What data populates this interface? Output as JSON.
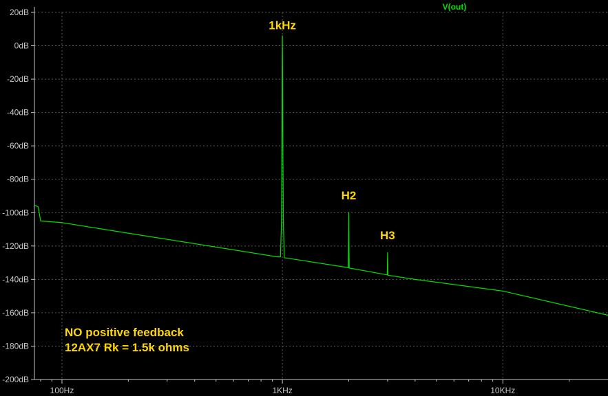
{
  "chart_data": {
    "type": "line",
    "trace_label": "V(out)",
    "x_scale": "log",
    "xlim_hz": [
      75,
      30000
    ],
    "ylim_db": [
      -200,
      20
    ],
    "y_ticks": [
      "20dB",
      "0dB",
      "-20dB",
      "-40dB",
      "-60dB",
      "-80dB",
      "-100dB",
      "-120dB",
      "-140dB",
      "-160dB",
      "-180dB",
      "-200dB"
    ],
    "x_ticks": [
      {
        "label": "100Hz",
        "freq": 100
      },
      {
        "label": "1KHz",
        "freq": 1000
      },
      {
        "label": "10KHz",
        "freq": 10000
      }
    ],
    "grid": true,
    "colors": {
      "trace": "#00e000",
      "annotation": "#ffd700",
      "grid": "#5a5a5a",
      "axis": "#c8c8c8"
    },
    "series": [
      {
        "name": "V(out)",
        "points": [
          [
            75,
            -95.5
          ],
          [
            78,
            -96.5
          ],
          [
            80,
            -105
          ],
          [
            100,
            -106
          ],
          [
            300,
            -116
          ],
          [
            950,
            -126.5
          ],
          [
            980,
            -126.5
          ],
          [
            990,
            -106
          ],
          [
            995,
            -60
          ],
          [
            998,
            -16
          ],
          [
            1000,
            6
          ],
          [
            1002,
            -16
          ],
          [
            1005,
            -60
          ],
          [
            1010,
            -106
          ],
          [
            1020,
            -127
          ],
          [
            2000,
            -133
          ],
          [
            1990,
            -133
          ],
          [
            1995,
            -118
          ],
          [
            1998,
            -108
          ],
          [
            2000,
            -100
          ],
          [
            2002,
            -108
          ],
          [
            2005,
            -118
          ],
          [
            2010,
            -133.2
          ],
          [
            2990,
            -137.3
          ],
          [
            2995,
            -130
          ],
          [
            3000,
            -124
          ],
          [
            3005,
            -130
          ],
          [
            3010,
            -137.5
          ],
          [
            4000,
            -140
          ],
          [
            10000,
            -147
          ],
          [
            30000,
            -161.5
          ]
        ]
      }
    ],
    "annotations": [
      {
        "text": "1kHz",
        "freq": 1000,
        "db": 10
      },
      {
        "text": "H2",
        "freq": 2000,
        "db": -92
      },
      {
        "text": "H3",
        "freq": 3000,
        "db": -116
      }
    ]
  },
  "notes": {
    "line1": "NO positive feedback",
    "line2": "12AX7 Rk = 1.5k ohms"
  }
}
